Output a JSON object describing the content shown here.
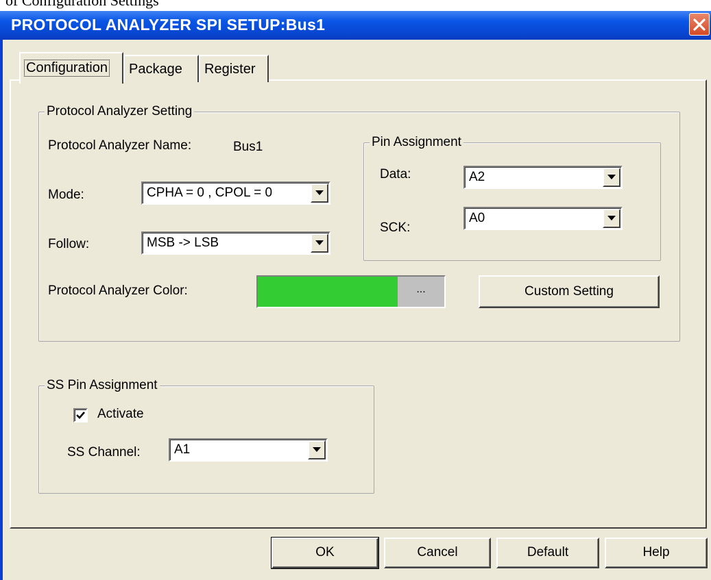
{
  "background_text": "of Configuration Settings",
  "window": {
    "title": "PROTOCOL ANALYZER SPI SETUP:Bus1",
    "close_icon": "close-icon"
  },
  "tabs": [
    {
      "label": "Configuration",
      "active": true
    },
    {
      "label": "Package",
      "active": false
    },
    {
      "label": "Register",
      "active": false
    }
  ],
  "pa_setting": {
    "group_title": "Protocol Analyzer Setting",
    "name_label": "Protocol Analyzer Name:",
    "name_value": "Bus1",
    "mode_label": "Mode:",
    "mode_value": "CPHA = 0 , CPOL = 0",
    "follow_label": "Follow:",
    "follow_value": "MSB -> LSB",
    "color_label": "Protocol Analyzer Color:",
    "color_hex": "#33cc33",
    "color_button_label": "...",
    "custom_button": "Custom Setting"
  },
  "pin_assignment": {
    "group_title": "Pin Assignment",
    "data_label": "Data:",
    "data_value": "A2",
    "sck_label": "SCK:",
    "sck_value": "A0"
  },
  "ss_pin": {
    "group_title": "SS Pin Assignment",
    "activate_label": "Activate",
    "activate_checked": true,
    "channel_label": "SS Channel:",
    "channel_value": "A1"
  },
  "buttons": {
    "ok": "OK",
    "cancel": "Cancel",
    "default": "Default",
    "help": "Help"
  },
  "colors": {
    "title_bar": "#0a56e6",
    "dialog_bg": "#ece9d8",
    "close_button": "#d95a36"
  }
}
